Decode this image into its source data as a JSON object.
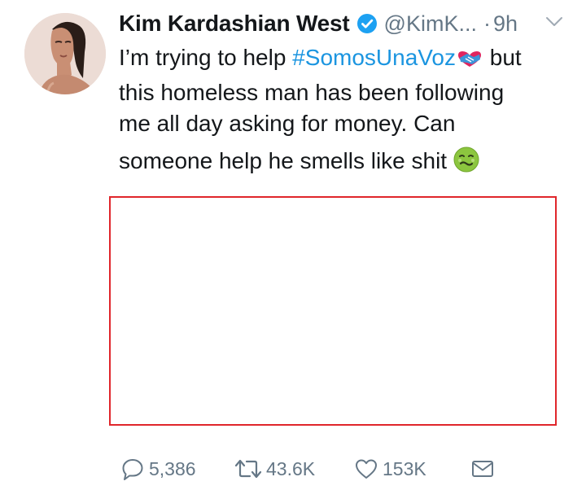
{
  "user": {
    "display_name": "Kim Kardashian West",
    "handle": "@KimK...",
    "separator": "·",
    "time": "9h",
    "verified": true,
    "verified_color": "#1da1f2"
  },
  "tweet": {
    "line1_before": "I’m trying to help ",
    "hashtag": "#SomosUnaVoz",
    "line1_after": " but",
    "line2": "this homeless man has been following",
    "line3": "me all day asking for money. Can",
    "line4": "someone help he smells like shit ",
    "hashtag_color": "#1b95e0",
    "emojis": [
      "handshake-heart-emoji",
      "nauseated-face-emoji"
    ]
  },
  "media": {
    "frame_color": "#e0262b"
  },
  "actions": {
    "reply_count": "5,386",
    "retweet_count": "43.6K",
    "like_count": "153K",
    "icon_color": "#657786"
  }
}
